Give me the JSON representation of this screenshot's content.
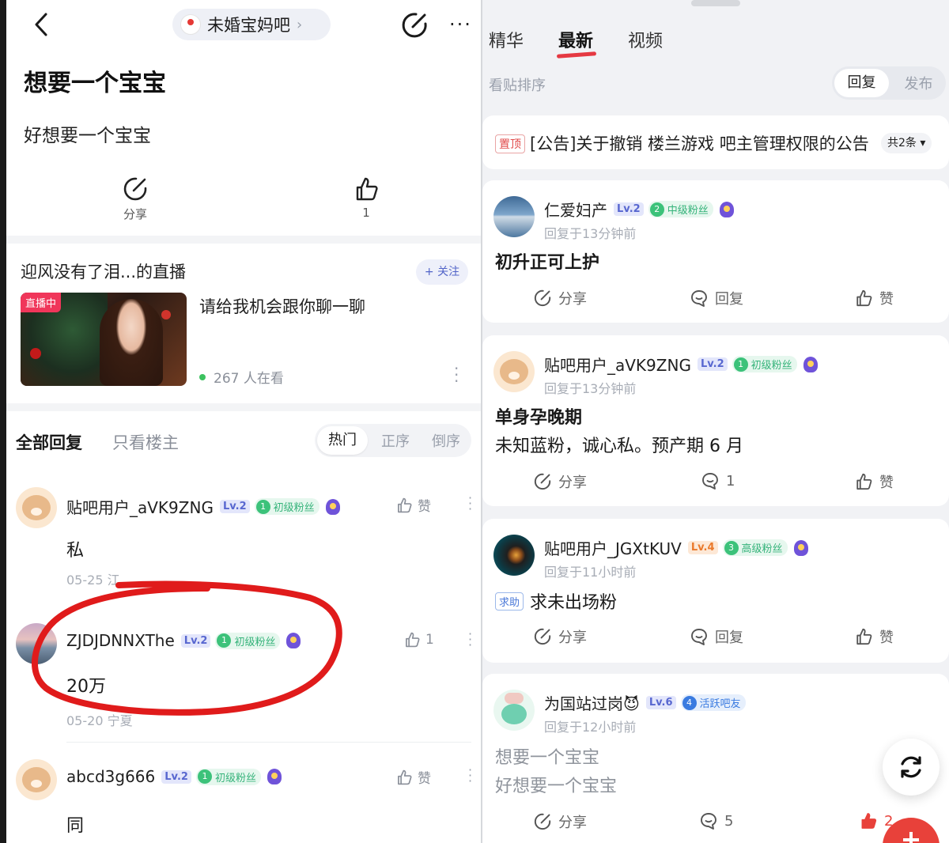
{
  "left": {
    "header": {
      "forum_name": "未婚宝妈吧",
      "chevron": "›",
      "more": "···",
      "icons": [
        "back-arrow-icon",
        "edit-icon",
        "more-icon"
      ]
    },
    "post": {
      "title": "想要一个宝宝",
      "body": "好想要一个宝宝",
      "share_label": "分享",
      "like_count": "1"
    },
    "live": {
      "title": "迎风没有了泪...的直播",
      "follow_label": "+ 关注",
      "badge": "直播中",
      "text": "请给我机会跟你聊一聊",
      "viewers": "267 人在看"
    },
    "replies": {
      "tab_all": "全部回复",
      "tab_host": "只看楼主",
      "sort": [
        "热门",
        "正序",
        "倒序"
      ],
      "items": [
        {
          "user": "贴吧用户_aVK9ZNG",
          "level": "Lv.2",
          "fan_level": "1",
          "fan_title": "初级粉丝",
          "like": "赞",
          "text": "私",
          "meta": "05-25   江"
        },
        {
          "user": "ZJDJDNNXThe",
          "level": "Lv.2",
          "fan_level": "1",
          "fan_title": "初级粉丝",
          "like": "1",
          "text": "20万",
          "meta": "05-20   宁夏"
        },
        {
          "user": "abcd3g666",
          "level": "Lv.2",
          "fan_level": "1",
          "fan_title": "初级粉丝",
          "like": "赞",
          "text": "同"
        }
      ]
    },
    "annotation_color": "#e01b1b"
  },
  "right": {
    "tabs": [
      "精华",
      "最新",
      "视频"
    ],
    "active_tab": "最新",
    "sort_label": "看贴排序",
    "sort": [
      "回复",
      "发布"
    ],
    "pinned": {
      "tag": "置顶",
      "text": "[公告]关于撤销 楼兰游戏 吧主管理权限的公告",
      "count": "共2条"
    },
    "threads": [
      {
        "user": "仁爱妇产",
        "level": "Lv.2",
        "fan_level": "2",
        "fan_title": "中级粉丝",
        "time": "回复于13分钟前",
        "title": "初升正可上护",
        "share": "分享",
        "comment": "回复",
        "like": "赞"
      },
      {
        "user": "贴吧用户_aVK9ZNG",
        "level": "Lv.2",
        "fan_level": "1",
        "fan_title": "初级粉丝",
        "time": "回复于13分钟前",
        "title": "单身孕晚期",
        "body": "未知蓝粉，诚心私。预产期 6 月",
        "share": "分享",
        "comment": "1",
        "like": "赞"
      },
      {
        "user": "贴吧用户_JGXtKUV",
        "level": "Lv.4",
        "fan_level": "3",
        "fan_title": "高级粉丝",
        "time": "回复于11小时前",
        "tag": "求助",
        "title": "求未出场粉",
        "share": "分享",
        "comment": "回复",
        "like": "赞"
      },
      {
        "user": "为国站过岗😈",
        "level": "Lv.6",
        "fan_level": "4",
        "fan_title": "活跃吧友",
        "time": "回复于12小时前",
        "title": "想要一个宝宝",
        "body": "好想要一个宝宝",
        "share": "分享",
        "comment": "5",
        "like": "2"
      }
    ]
  }
}
